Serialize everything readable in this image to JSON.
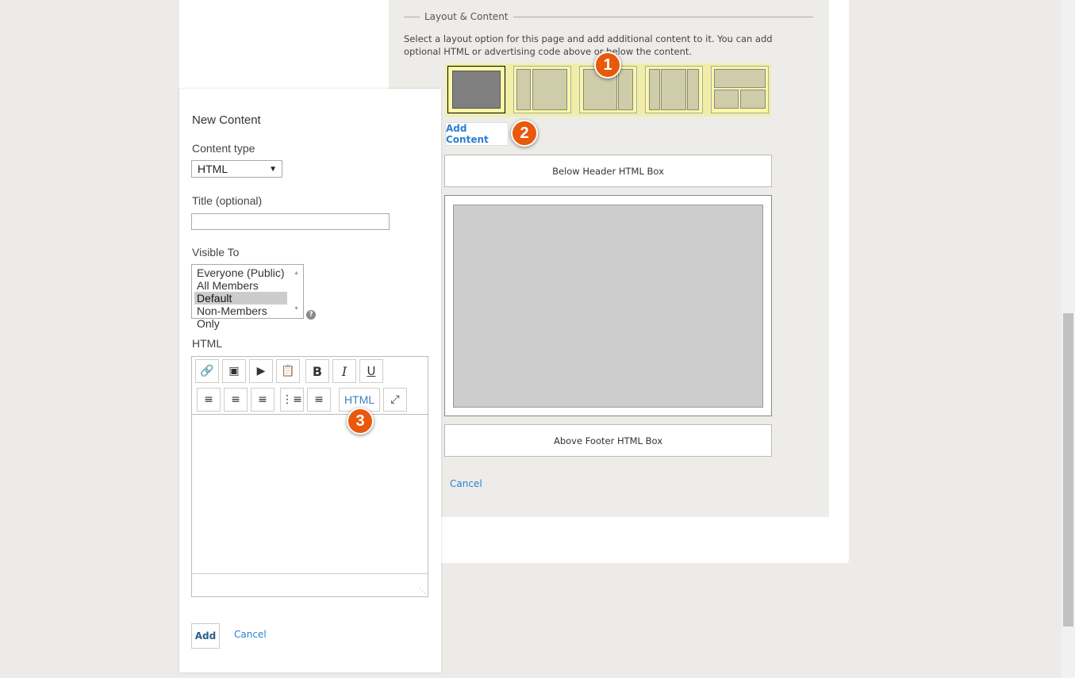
{
  "section": {
    "title": "Layout & Content",
    "description": "Select a layout option for this page and add additional content to it. You can add optional HTML or advertising code above or below the content."
  },
  "layouts": [
    {
      "name": "single-column",
      "selected": true
    },
    {
      "name": "left-sidebar",
      "selected": false
    },
    {
      "name": "right-sidebar",
      "selected": false
    },
    {
      "name": "three-column",
      "selected": false
    },
    {
      "name": "header-two-column",
      "selected": false
    }
  ],
  "badges": [
    "1",
    "2",
    "3"
  ],
  "add_content_label": "Add Content",
  "below_header_label": "Below Header HTML Box",
  "above_footer_label": "Above Footer HTML Box",
  "cancel_label": "Cancel",
  "colors": {
    "accent": "#2a7fd4",
    "badge": "#e8590c",
    "layout_bg": "#f0eea8"
  },
  "popup": {
    "title": "New Content",
    "content_type_label": "Content type",
    "content_type_value": "HTML",
    "title_label": "Title (optional)",
    "title_value": "",
    "visible_label": "Visible To",
    "visible_options": [
      "Everyone (Public)",
      "All Members",
      "Default",
      "Non-Members Only"
    ],
    "visible_selected": "Default",
    "help_icon": "?",
    "html_label": "HTML",
    "toolbar": {
      "html_button": "HTML",
      "bold": "B",
      "italic": "I",
      "underline": "U"
    },
    "add_label": "Add",
    "cancel_label": "Cancel"
  }
}
